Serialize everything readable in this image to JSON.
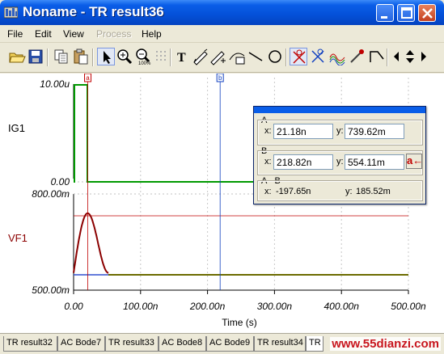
{
  "window": {
    "title": "Noname - TR result36"
  },
  "menu": [
    {
      "label": "File",
      "enabled": true
    },
    {
      "label": "Edit",
      "enabled": true
    },
    {
      "label": "View",
      "enabled": true
    },
    {
      "label": "Process",
      "enabled": false
    },
    {
      "label": "Help",
      "enabled": true
    }
  ],
  "toolbar_icons": [
    "open-folder-icon",
    "save-icon",
    "copy-icon",
    "paste-icon",
    "pointer-icon",
    "zoom-in-icon",
    "zoom-out-icon",
    "zoom-100-icon",
    "grid-icon",
    "text-icon",
    "pen-tool-icon",
    "pen-tool-2-icon",
    "curve-icon",
    "line-icon",
    "ellipse-icon",
    "cursor-a-icon",
    "cursor-b-icon",
    "waves-icon",
    "marker-icon",
    "slope-icon",
    "arrow-left-icon",
    "arrow-updown-icon",
    "arrow-right-icon"
  ],
  "plot": {
    "x_axis_label": "Time (s)",
    "x_ticks": [
      "0.00",
      "100.00n",
      "200.00n",
      "300.00n",
      "400.00n",
      "500.00n"
    ],
    "x_range_ns": [
      0,
      500
    ],
    "upper": {
      "signal": "IG1",
      "y_ticks": [
        "10.00u",
        "0.00"
      ],
      "color": "#009900"
    },
    "lower": {
      "signal": "VF1",
      "y_ticks": [
        "800.00m",
        "500.00m"
      ],
      "color": "#8b0000",
      "y_range_m": [
        500,
        800
      ]
    },
    "cursor_a_label": "a",
    "cursor_b_label": "b",
    "cursor_a_x_ns": 21.18,
    "cursor_b_x_ns": 218.82
  },
  "cursor_panel": {
    "a": {
      "label": "A",
      "x_label": "x:",
      "x": "21.18n",
      "y_label": "y:",
      "y": "739.62m"
    },
    "b": {
      "label": "B",
      "x_label": "x:",
      "x": "218.82n",
      "y_label": "y:",
      "y": "554.11m"
    },
    "diff": {
      "label": "A - B",
      "x_label": "x:",
      "x": "-197.65n",
      "y_label": "y:",
      "y": "185.52m"
    },
    "swap_button": "a←"
  },
  "tabs": [
    "TR result32",
    "AC Bode7",
    "TR result33",
    "AC Bode8",
    "AC Bode9",
    "TR result34",
    "TR"
  ],
  "watermark": "www.55dianzi.com"
}
